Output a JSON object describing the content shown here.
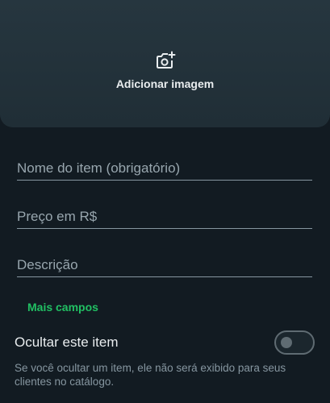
{
  "image_area": {
    "label": "Adicionar imagem",
    "icon": "add-photo-icon"
  },
  "fields": {
    "name_placeholder": "Nome do item (obrigatório)",
    "name_value": "",
    "price_placeholder": "Preço em R$",
    "price_value": "",
    "description_placeholder": "Descrição",
    "description_value": ""
  },
  "more_fields_label": "Mais campos",
  "hide_item": {
    "title": "Ocultar este item",
    "enabled": false,
    "description": "Se você ocultar um item, ele não será exibido para seus clientes no catálogo."
  },
  "colors": {
    "background": "#121b22",
    "panel": "#202e36",
    "accent": "#21c063",
    "text_primary": "#e9edef",
    "text_secondary": "#8696a0"
  }
}
